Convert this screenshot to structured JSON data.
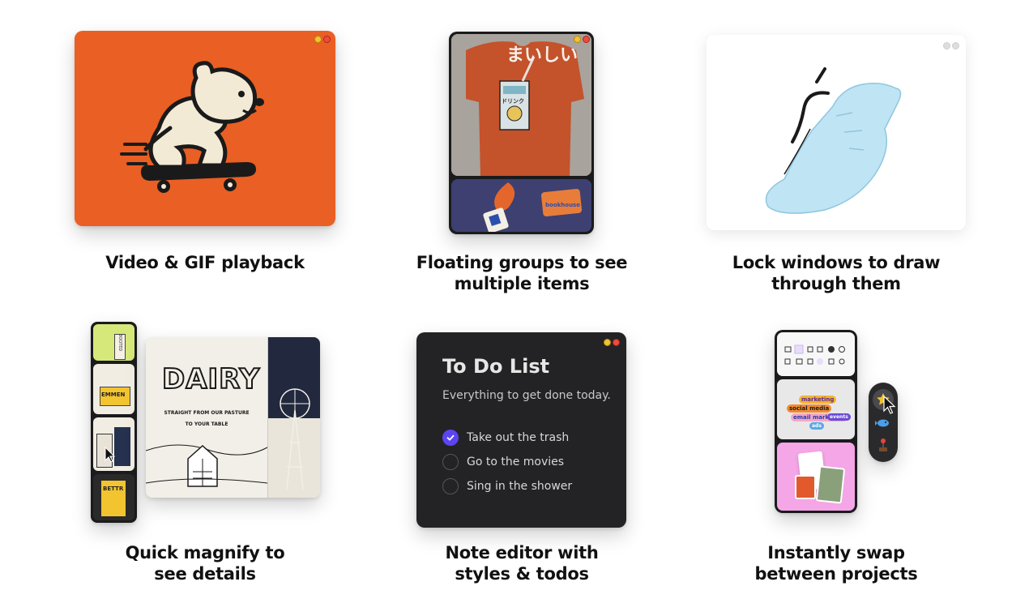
{
  "features": [
    {
      "caption": "Video & GIF playback"
    },
    {
      "caption": "Floating groups to see\nmultiple items"
    },
    {
      "caption": "Lock windows to draw\nthrough them"
    },
    {
      "caption": "Quick magnify to\nsee details"
    },
    {
      "caption": "Note editor with\nstyles & todos"
    },
    {
      "caption": "Instantly swap\nbetween projects"
    }
  ],
  "card2": {
    "shirt_text": "まいしい",
    "pack_text": "ドリンク",
    "sticker_text": "bookhouse"
  },
  "card4": {
    "poster_title": "DAIRY",
    "poster_tagline_1": "STRAIGHT FROM OUR PASTURE",
    "poster_tagline_2": "TO YOUR TABLE",
    "thumb_labels": [
      "BOOTED",
      "EMMEN",
      "",
      "BETTR"
    ]
  },
  "todo": {
    "title": "To Do List",
    "subtitle": "Everything to get done today.",
    "items": [
      {
        "label": "Take out the trash",
        "done": true
      },
      {
        "label": "Go to the movies",
        "done": false
      },
      {
        "label": "Sing in the shower",
        "done": false
      }
    ]
  },
  "card6": {
    "tags": [
      "marketing",
      "social media",
      "email marketing",
      "ads",
      "events"
    ]
  },
  "colors": {
    "accent": "#5b45ef",
    "orange": "#ea5f23",
    "dark_window": "#232325",
    "min_button": "#f2c230",
    "close_button": "#f04a3e"
  }
}
